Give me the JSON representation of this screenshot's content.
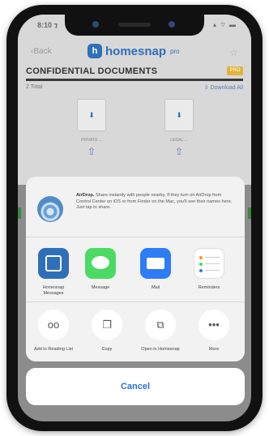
{
  "status_bar": {
    "time": "8:10 ⁊",
    "indicators": "▴ ⌔ ▬"
  },
  "nav": {
    "back_label": "Back",
    "logo_mark": "h",
    "logo_text": "homesnap",
    "logo_suffix": "pro",
    "star": "☆"
  },
  "section": {
    "title": "CONFIDENTIAL DOCUMENTS",
    "badge": "PRO",
    "total": "2 Total",
    "download_all": "⇩ Download All"
  },
  "documents": [
    {
      "name": "PRIVATE ...",
      "share": "⇧"
    },
    {
      "name": "LEGAL ...",
      "share": "⇧"
    }
  ],
  "share_sheet": {
    "airdrop_title": "AirDrop.",
    "airdrop_body": "Share instantly with people nearby. If they turn on AirDrop from Control Center on iOS or from Finder on the Mac, you'll see their names here. Just tap to share.",
    "apps": [
      {
        "label": "Homesnap Messages"
      },
      {
        "label": "Message"
      },
      {
        "label": "Mail"
      },
      {
        "label": "Reminders"
      }
    ],
    "actions": [
      {
        "label": "Add to Reading List",
        "glyph": "oo"
      },
      {
        "label": "Copy",
        "glyph": "❐"
      },
      {
        "label": "Open in Homesnap",
        "glyph": "⧉"
      },
      {
        "label": "More",
        "glyph": "•••"
      }
    ],
    "cancel_label": "Cancel"
  },
  "colors": {
    "accent": "#2e6fd6",
    "brand": "#2f6fb8",
    "badge": "#e3b23c"
  }
}
